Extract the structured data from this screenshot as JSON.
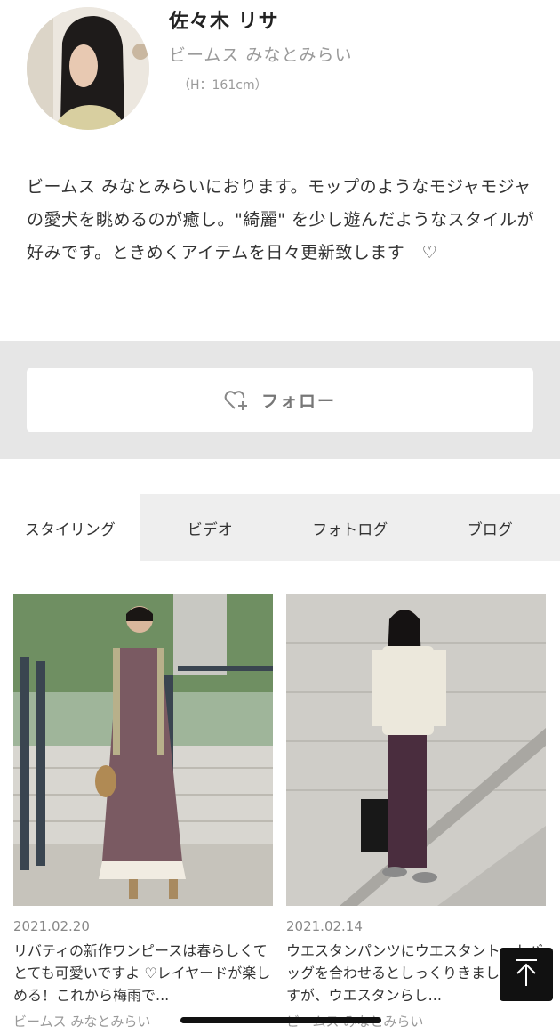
{
  "profile": {
    "name": "佐々木 リサ",
    "shop": "ビームス みなとみらい",
    "height": "（H：161cm）",
    "bio": "ビームス みなとみらいにおります。モップのようなモジャモジャの愛犬を眺めるのが癒し。\"綺麗\" を少し遊んだようなスタイルが好みです。ときめくアイテムを日々更新致します　♡"
  },
  "follow": {
    "label": "フォロー",
    "icon": "heart-plus-icon"
  },
  "tabs": [
    {
      "label": "スタイリング",
      "active": true
    },
    {
      "label": "ビデオ",
      "active": false
    },
    {
      "label": "フォトログ",
      "active": false
    },
    {
      "label": "ブログ",
      "active": false
    }
  ],
  "posts": [
    {
      "date": "2021.02.20",
      "title": "リバティの新作ワンピースは春らしくてとても可愛いですよ ♡レイヤードが楽しめる！これから梅雨で...",
      "shop": "ビームス みなとみらい"
    },
    {
      "date": "2021.02.14",
      "title": "ウエスタンパンツにウエスタントートバッグを合わせるとしっくりきました。ですが、ウエスタンらし...",
      "shop": "ビームス みなとみらい"
    }
  ],
  "back_to_top_icon": "arrow-up-icon"
}
